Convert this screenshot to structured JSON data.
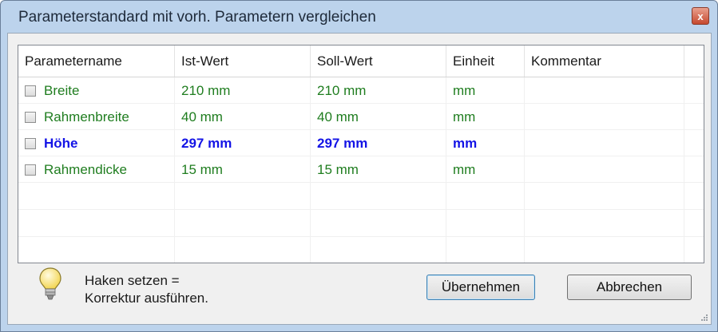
{
  "window": {
    "title": "Parameterstandard mit vorh. Parametern vergleichen",
    "close_glyph": "x"
  },
  "table": {
    "columns": [
      "Parametername",
      "Ist-Wert",
      "Soll-Wert",
      "Einheit",
      "Kommentar"
    ],
    "rows": [
      {
        "name": "Breite",
        "ist": "210 mm",
        "soll": "210 mm",
        "unit": "mm",
        "comment": "",
        "checked": false,
        "color": "#1f7d1f",
        "bold": false
      },
      {
        "name": "Rahmenbreite",
        "ist": "40 mm",
        "soll": "40 mm",
        "unit": "mm",
        "comment": "",
        "checked": false,
        "color": "#1f7d1f",
        "bold": false
      },
      {
        "name": "Höhe",
        "ist": "297 mm",
        "soll": "297 mm",
        "unit": "mm",
        "comment": "",
        "checked": false,
        "color": "#1414e6",
        "bold": true
      },
      {
        "name": "Rahmendicke",
        "ist": "15 mm",
        "soll": "15 mm",
        "unit": "mm",
        "comment": "",
        "checked": false,
        "color": "#1f7d1f",
        "bold": false
      }
    ]
  },
  "hint": {
    "line1": "Haken setzen =",
    "line2": "Korrektur ausführen.",
    "icon": "lightbulb-icon"
  },
  "buttons": {
    "apply": "Übernehmen",
    "cancel": "Abbrechen"
  }
}
